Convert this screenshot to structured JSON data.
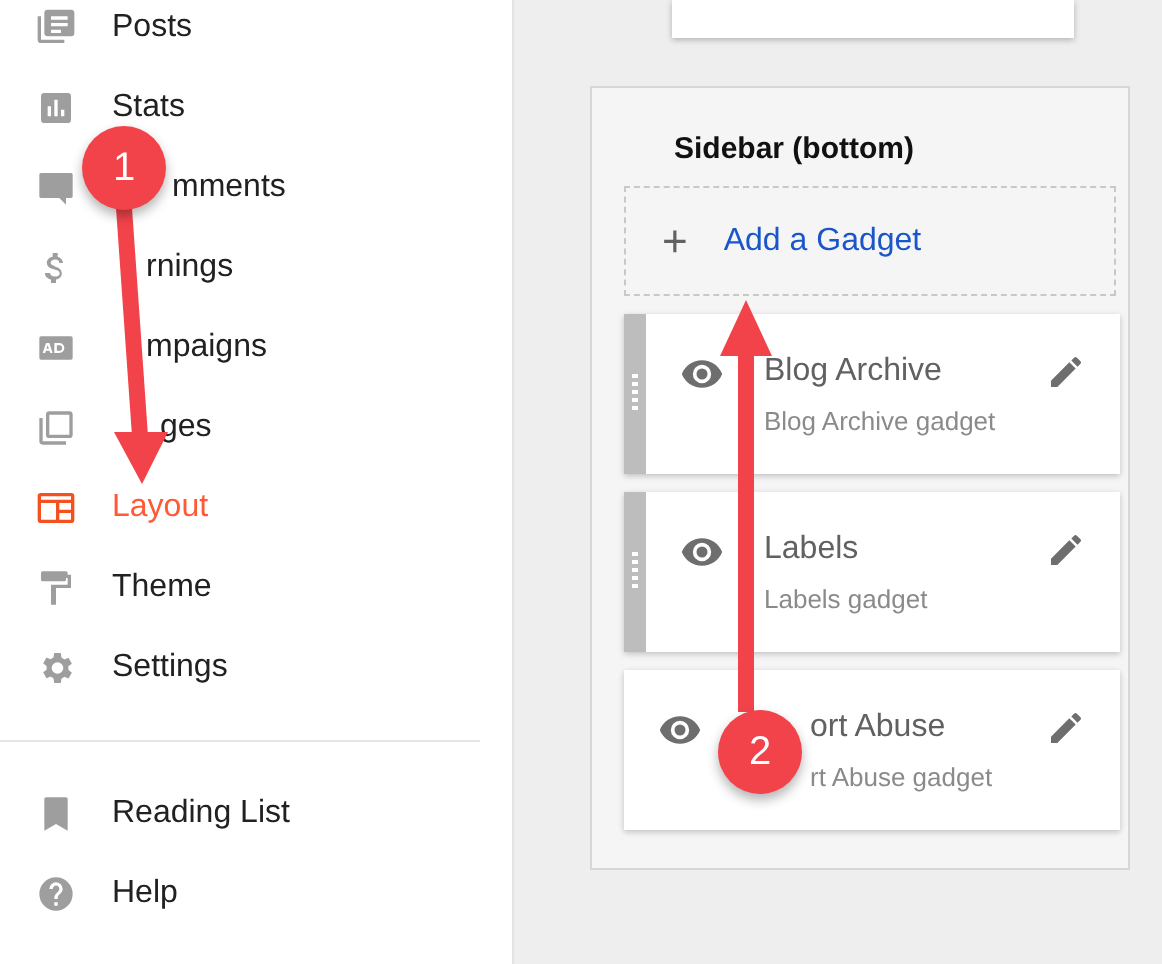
{
  "sidebar": {
    "items": [
      {
        "label": "Posts",
        "selected": false
      },
      {
        "label": "Stats",
        "selected": false
      },
      {
        "label": "mments",
        "selected": false
      },
      {
        "label": "rnings",
        "selected": false
      },
      {
        "label": "mpaigns",
        "selected": false
      },
      {
        "label": "ges",
        "selected": false
      },
      {
        "label": "Layout",
        "selected": true
      },
      {
        "label": "Theme",
        "selected": false
      },
      {
        "label": "Settings",
        "selected": false
      }
    ],
    "secondary_items": [
      {
        "label": "Reading List"
      },
      {
        "label": "Help"
      }
    ]
  },
  "layout_panel": {
    "title": "Sidebar (bottom)",
    "add_gadget": "Add a Gadget",
    "add_icon": "+",
    "gadgets": [
      {
        "title": "Blog Archive",
        "subtitle": "Blog Archive gadget",
        "draggable": true
      },
      {
        "title": "Labels",
        "subtitle": "Labels gadget",
        "draggable": true
      },
      {
        "title": "ort Abuse",
        "subtitle": "rt Abuse gadget",
        "draggable": false
      }
    ]
  },
  "annotations": [
    {
      "number": "1"
    },
    {
      "number": "2"
    }
  ]
}
